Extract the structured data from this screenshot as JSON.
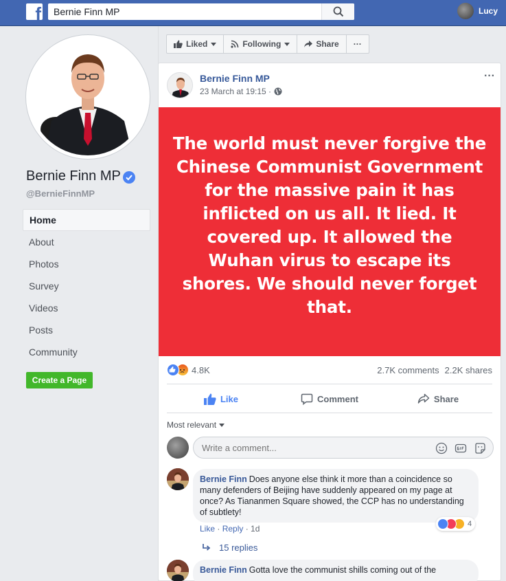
{
  "topbar": {
    "logo_letter": "f",
    "search_value": "Bernie Finn MP",
    "user_name": "Lucy"
  },
  "page": {
    "name": "Bernie Finn MP",
    "handle": "@BernieFinnMP",
    "nav": [
      "Home",
      "About",
      "Photos",
      "Survey",
      "Videos",
      "Posts",
      "Community"
    ],
    "create_page_label": "Create a Page"
  },
  "actions": {
    "liked": "Liked",
    "following": "Following",
    "share": "Share",
    "more": "···"
  },
  "post": {
    "author": "Bernie Finn MP",
    "time": "23 March at 19:15 ·",
    "menu": "···",
    "image_text": "The world must never forgive the Chinese Communist Government for the massive pain it has inflicted on us all. It lied. It covered up. It allowed the Wuhan virus to escape its shores. We should never forget that.",
    "reaction_count": "4.8K",
    "comments_count": "2.7K comments",
    "shares_count": "2.2K shares",
    "like_label": "Like",
    "comment_label": "Comment",
    "share_label": "Share",
    "sort_label": "Most relevant",
    "comment_placeholder": "Write a comment..."
  },
  "comments": [
    {
      "author": "Bernie Finn",
      "text": "Does anyone else think it more than a coincidence so many defenders of Beijing have suddenly appeared on my page at once? As Tiananmen Square showed, the CCP has no understanding of subtlety!",
      "like": "Like",
      "reply": "Reply",
      "age": "1d",
      "reaction_count": "4",
      "replies": "15 replies"
    },
    {
      "author": "Bernie Finn",
      "text": "Gotta love the communist shills coming out of the"
    }
  ],
  "colors": {
    "brand_blue": "#4267b2",
    "image_red": "#ee2e37",
    "create_green": "#42b72a",
    "link_blue": "#385898"
  }
}
